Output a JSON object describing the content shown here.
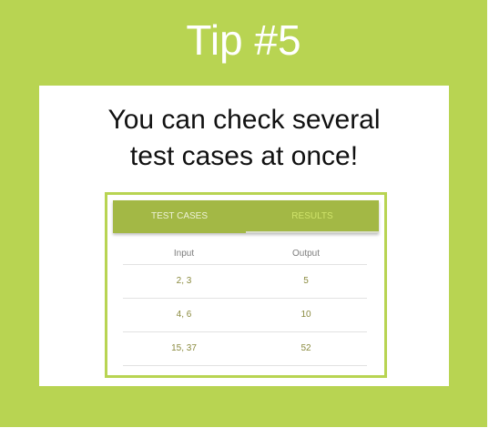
{
  "title": "Tip #5",
  "headline": {
    "line1": "You can check several",
    "line2": "test cases at once!"
  },
  "tabs": [
    {
      "label": "TEST CASES"
    },
    {
      "label": "RESULTS"
    }
  ],
  "table": {
    "columns": [
      "Input",
      "Output"
    ],
    "rows": [
      {
        "input": "2, 3",
        "output": "5"
      },
      {
        "input": "4, 6",
        "output": "10"
      },
      {
        "input": "15, 37",
        "output": "52"
      }
    ]
  },
  "colors": {
    "background": "#b8d452",
    "tab_bar": "#a3b845",
    "text_dark": "#111111"
  }
}
